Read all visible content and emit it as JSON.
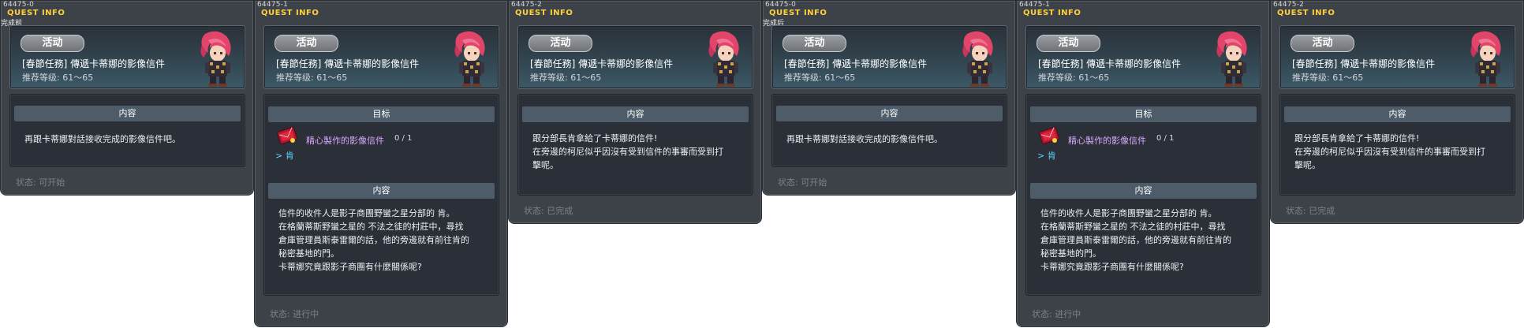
{
  "header_common": {
    "panel_title": "QUEST INFO",
    "badge_label": "活动",
    "quest_name": "[春節任務] 傳遞卡蒂娜的影像信件",
    "level_label": "推荐等级:",
    "level_range": "61～65",
    "status_label": "状态:"
  },
  "panels": [
    {
      "id": "64475-0",
      "note": "完成前",
      "section_title": "内容",
      "content_lines": [
        "再跟卡蒂娜對話接收完成的影像信件吧。"
      ],
      "status_value": "可开始"
    },
    {
      "id": "64475-1",
      "goal_title": "目标",
      "goal_item_name": "精心製作的影像信件",
      "goal_item_count": "0 / 1",
      "goal_npc": "> 肯",
      "section_title": "内容",
      "content_lines": [
        "信件的收件人是影子商團野蠻之星分部的 肯。",
        "在格蘭蒂斯野蠻之星的 不法之徒的村莊中，尋找",
        "倉庫管理員斯泰雷爾的話，他的旁邊就有前往肯的",
        "秘密基地的門。",
        "卡蒂娜究竟跟影子商團有什麼關係呢?"
      ],
      "status_value": "进行中"
    },
    {
      "id": "64475-2",
      "section_title": "内容",
      "content_lines": [
        "跟分部長肯拿給了卡蒂娜的信件!",
        "在旁邊的柯尼似乎因沒有受到信件的事審而受到打",
        "擊呢。"
      ],
      "status_value": "已完成"
    },
    {
      "id": "64475-0",
      "note": "完成后",
      "section_title": "内容",
      "content_lines": [
        "再跟卡蒂娜對話接收完成的影像信件吧。"
      ],
      "status_value": "可开始"
    },
    {
      "id": "64475-1",
      "goal_title": "目标",
      "goal_item_name": "精心製作的影像信件",
      "goal_item_count": "0 / 1",
      "goal_npc": "> 肯",
      "section_title": "内容",
      "content_lines": [
        "信件的收件人是影子商團野蠻之星分部的 肯。",
        "在格蘭蒂斯野蠻之星的 不法之徒的村莊中，尋找",
        "倉庫管理員斯泰雷爾的話，他的旁邊就有前往肯的",
        "秘密基地的門。",
        "卡蒂娜究竟跟影子商團有什麼關係呢?"
      ],
      "status_value": "进行中"
    },
    {
      "id": "64475-2",
      "section_title": "内容",
      "content_lines": [
        "跟分部長肯拿給了卡蒂娜的信件!",
        "在旁邊的柯尼似乎因沒有受到信件的事審而受到打",
        "擊呢。"
      ],
      "status_value": "已完成"
    }
  ],
  "colors": {
    "panel_bg": "#3d4248",
    "title_yellow": "#ffd23c",
    "item_purple": "#d9a8ff",
    "npc_cyan": "#58d6ff"
  },
  "icons": {
    "avatar": "character-portrait-icon",
    "item": "letter-item-icon"
  }
}
